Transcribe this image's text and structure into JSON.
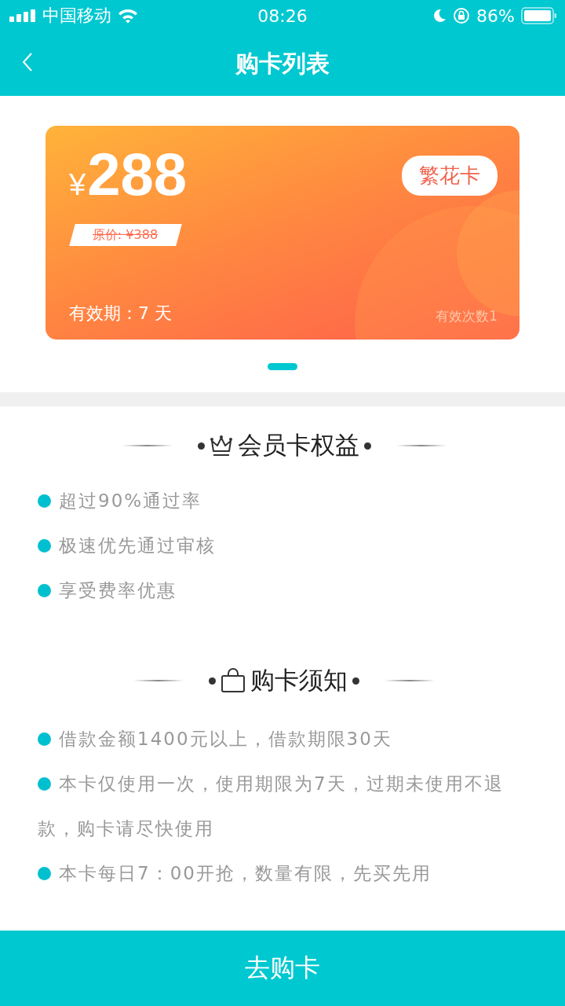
{
  "status_bar": {
    "carrier": "中国移动",
    "time": "08:26",
    "battery": "86%"
  },
  "nav": {
    "title": "购卡列表"
  },
  "card": {
    "currency": "¥",
    "price": "288",
    "original_price": "原价: ¥388",
    "name": "繁花卡",
    "validity": "有效期：7 天",
    "uses": "有效次数1"
  },
  "pager": [
    {
      "selected": true
    }
  ],
  "sections": [
    {
      "title": "会员卡权益",
      "kind": "benefits",
      "items": [
        "超过90%通过率",
        "极速优先通过审核",
        "享受费率优惠"
      ]
    },
    {
      "title": "购卡须知",
      "kind": "notice",
      "items": [
        "借款金额1400元以上，借款期限30天",
        "本卡仅使用一次，使用期限为7天，过期未使用不退款，购卡请尽快使用",
        "本卡每日7：00开抢，数量有限，先买先用"
      ]
    }
  ],
  "buy_button": "去购卡"
}
